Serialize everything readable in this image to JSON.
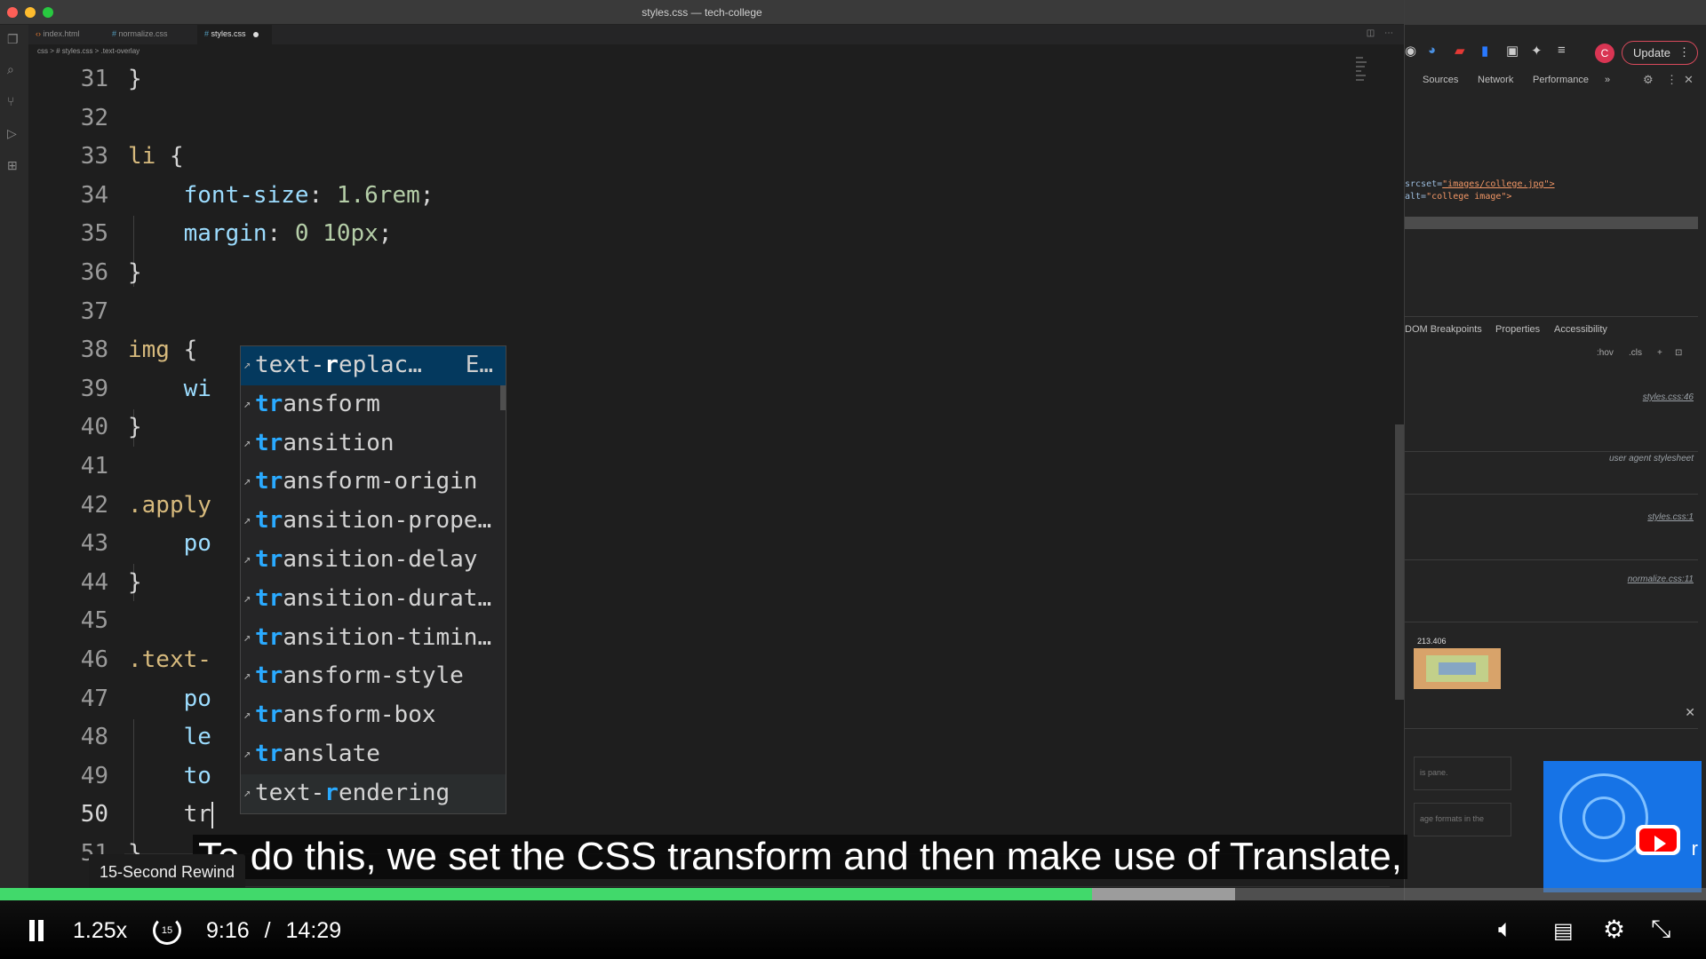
{
  "window": {
    "title": "styles.css — tech-college"
  },
  "tabs": [
    {
      "label": "index.html"
    },
    {
      "label": "normalize.css"
    },
    {
      "label": "styles.css"
    }
  ],
  "breadcrumb": "css > # styles.css > .text-overlay",
  "code_lines": [
    {
      "n": "31",
      "segs": [
        {
          "t": "}",
          "c": ""
        }
      ]
    },
    {
      "n": "32",
      "segs": []
    },
    {
      "n": "33",
      "segs": [
        {
          "t": "li",
          "c": "sel"
        },
        {
          "t": " {",
          "c": ""
        }
      ]
    },
    {
      "n": "34",
      "segs": [
        {
          "t": "    ",
          "c": ""
        },
        {
          "t": "font-size",
          "c": "prop"
        },
        {
          "t": ": ",
          "c": ""
        },
        {
          "t": "1.6rem",
          "c": "num"
        },
        {
          "t": ";",
          "c": ""
        }
      ]
    },
    {
      "n": "35",
      "segs": [
        {
          "t": "    ",
          "c": ""
        },
        {
          "t": "margin",
          "c": "prop"
        },
        {
          "t": ": ",
          "c": ""
        },
        {
          "t": "0 10px",
          "c": "num"
        },
        {
          "t": ";",
          "c": ""
        }
      ]
    },
    {
      "n": "36",
      "segs": [
        {
          "t": "}",
          "c": ""
        }
      ]
    },
    {
      "n": "37",
      "segs": []
    },
    {
      "n": "38",
      "segs": [
        {
          "t": "img",
          "c": "sel"
        },
        {
          "t": " {",
          "c": ""
        }
      ]
    },
    {
      "n": "39",
      "segs": [
        {
          "t": "    ",
          "c": ""
        },
        {
          "t": "wi",
          "c": "prop"
        }
      ]
    },
    {
      "n": "40",
      "segs": [
        {
          "t": "}",
          "c": ""
        }
      ]
    },
    {
      "n": "41",
      "segs": []
    },
    {
      "n": "42",
      "segs": [
        {
          "t": ".apply",
          "c": "sel"
        }
      ]
    },
    {
      "n": "43",
      "segs": [
        {
          "t": "    ",
          "c": ""
        },
        {
          "t": "po",
          "c": "prop"
        }
      ]
    },
    {
      "n": "44",
      "segs": [
        {
          "t": "}",
          "c": ""
        }
      ]
    },
    {
      "n": "45",
      "segs": []
    },
    {
      "n": "46",
      "segs": [
        {
          "t": ".text-",
          "c": "sel"
        }
      ]
    },
    {
      "n": "47",
      "segs": [
        {
          "t": "    ",
          "c": ""
        },
        {
          "t": "po",
          "c": "prop"
        }
      ]
    },
    {
      "n": "48",
      "segs": [
        {
          "t": "    ",
          "c": ""
        },
        {
          "t": "le",
          "c": "prop"
        }
      ]
    },
    {
      "n": "49",
      "segs": [
        {
          "t": "    ",
          "c": ""
        },
        {
          "t": "to",
          "c": "prop"
        }
      ]
    },
    {
      "n": "50",
      "segs": [
        {
          "t": "    ",
          "c": ""
        },
        {
          "t": "tr",
          "c": ""
        }
      ]
    },
    {
      "n": "51",
      "segs": [
        {
          "t": "}",
          "c": ""
        }
      ]
    }
  ],
  "current_line": "50",
  "suggestions": [
    {
      "pre": "text-",
      "match": "r",
      "post": "eplac…",
      "detail": "E…"
    },
    {
      "pre": "",
      "match": "tr",
      "post": "ansform",
      "detail": ""
    },
    {
      "pre": "",
      "match": "tr",
      "post": "ansition",
      "detail": ""
    },
    {
      "pre": "",
      "match": "tr",
      "post": "ansform-origin",
      "detail": ""
    },
    {
      "pre": "",
      "match": "tr",
      "post": "ansition-prope…",
      "detail": ""
    },
    {
      "pre": "",
      "match": "tr",
      "post": "ansition-delay",
      "detail": ""
    },
    {
      "pre": "",
      "match": "tr",
      "post": "ansition-durat…",
      "detail": ""
    },
    {
      "pre": "",
      "match": "tr",
      "post": "ansition-timin…",
      "detail": ""
    },
    {
      "pre": "",
      "match": "tr",
      "post": "ansform-style",
      "detail": ""
    },
    {
      "pre": "",
      "match": "tr",
      "post": "ansform-box",
      "detail": ""
    },
    {
      "pre": "",
      "match": "tr",
      "post": "anslate",
      "detail": ""
    },
    {
      "pre": "text-",
      "match": "r",
      "post": "endering",
      "detail": ""
    }
  ],
  "devtools": {
    "update_label": "Update",
    "avatar_letter": "C",
    "tabs": [
      "Sources",
      "Network",
      "Performance",
      "»"
    ],
    "element_lines": [
      {
        "attr": "srcset=",
        "val": "\"images/college.jpg\">"
      },
      {
        "attr": "alt=",
        "val": "\"college image\">"
      }
    ],
    "sidebar_tabs": [
      "DOM Breakpoints",
      "Properties",
      "Accessibility"
    ],
    "filters": [
      ":hov",
      ".cls",
      "+"
    ],
    "style_sources": [
      "styles.css:46",
      "user agent stylesheet",
      "styles.css:1",
      "normalize.css:11"
    ],
    "box_model_value": "213.406",
    "ghost_lines": [
      "is pane.",
      "age formats in the"
    ]
  },
  "player": {
    "caption": "To do this, we set the CSS transform and then make use of Translate,",
    "tooltip": "15-Second Rewind",
    "speed": "1.25x",
    "current_time": "9:16",
    "separator": "/",
    "duration": "14:29",
    "rewind_seconds": "15",
    "progress": 0.64,
    "buffered": 0.724,
    "accent": "#41d96b"
  }
}
